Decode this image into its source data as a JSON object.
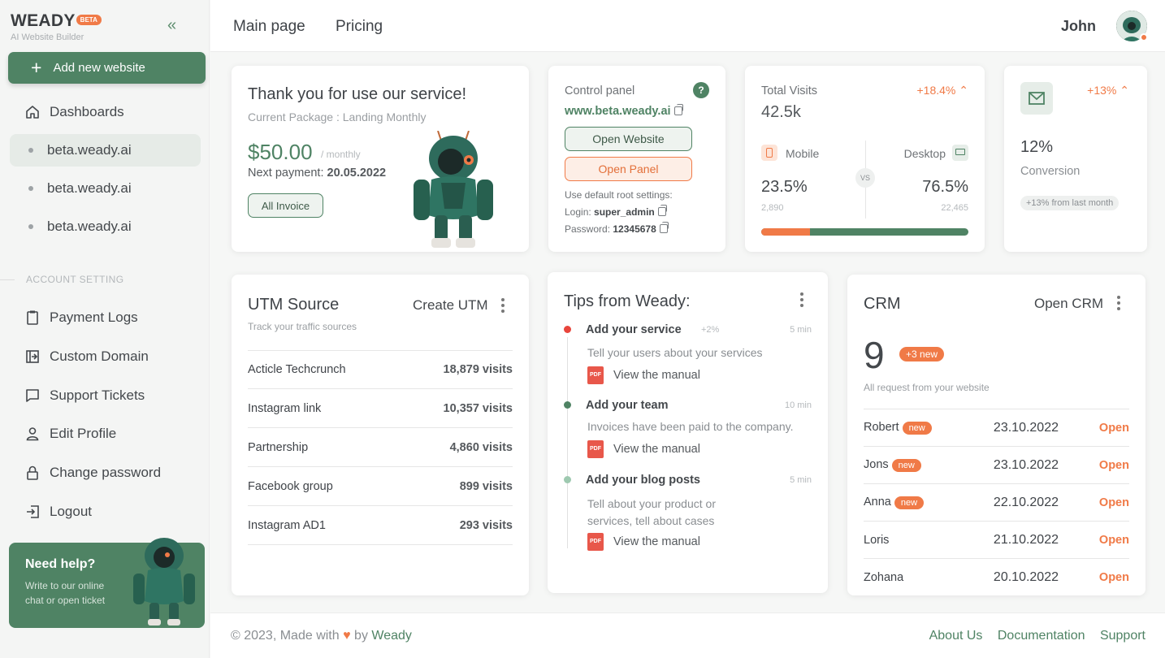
{
  "brand": {
    "name": "WEADY",
    "badge": "BETA",
    "subtitle": "AI Website Builder"
  },
  "sidebar": {
    "add_button": "Add new website",
    "dashboards": "Dashboards",
    "sites": [
      "beta.weady.ai",
      "beta.weady.ai",
      "beta.weady.ai"
    ],
    "section": "ACCOUNT SETTING",
    "items": [
      "Payment Logs",
      "Custom Domain",
      "Support Tickets",
      "Edit Profile",
      "Change password",
      "Logout"
    ],
    "help_title": "Need help?",
    "help_text": "Write to our online chat or open ticket"
  },
  "topbar": {
    "links": [
      "Main page",
      "Pricing"
    ],
    "user": "John"
  },
  "package": {
    "title": "Thank you for use our service!",
    "current": "Current Package : Landing Monthly",
    "price": "$50.00",
    "period": "/ monthly",
    "next_label": "Next payment:",
    "next_date": "20.05.2022",
    "invoice_button": "All Invoice"
  },
  "control": {
    "title": "Control panel",
    "help": "?",
    "domain": "www.beta.weady.ai",
    "open_website": "Open Website",
    "open_panel": "Open Panel",
    "note": "Use  default root settings:",
    "login_label": "Login:",
    "login": "super_admin",
    "password_label": "Password:",
    "password": "12345678"
  },
  "visits": {
    "title": "Total Visits",
    "value": "42.5k",
    "change": "+18.4%",
    "mobile_label": "Mobile",
    "desktop_label": "Desktop",
    "vs": "VS",
    "mobile_pct": "23.5%",
    "desktop_pct": "76.5%",
    "mobile_count": "2,890",
    "desktop_count": "22,465",
    "mobile_share": 0.235
  },
  "conversion": {
    "change": "+13%",
    "value": "12%",
    "label": "Conversion",
    "note": "+13% from last month"
  },
  "utm": {
    "title": "UTM Source",
    "subtitle": "Track your traffic sources",
    "create": "Create UTM",
    "rows": [
      {
        "source": "Acticle Techcrunch",
        "visits": "18,879 visits"
      },
      {
        "source": "Instagram link",
        "visits": "10,357 visits"
      },
      {
        "source": "Partnership",
        "visits": "4,860 visits"
      },
      {
        "source": "Facebook group",
        "visits": "899 visits"
      },
      {
        "source": "Instagram AD1",
        "visits": "293 visits"
      }
    ]
  },
  "tips": {
    "title": "Tips from Weady:",
    "manual": "View the manual",
    "pdf": "PDF",
    "items": [
      {
        "title": "Add your service",
        "extra": "+2%",
        "time": "5 min",
        "text": "Tell your users about your services",
        "color": "#e8453c"
      },
      {
        "title": "Add your team",
        "extra": "",
        "time": "10 min",
        "text": "Invoices have been paid to the company.",
        "color": "#4f8364"
      },
      {
        "title": "Add your blog posts",
        "extra": "",
        "time": "5 min",
        "text": "Tell about your product or services, tell about cases",
        "color": "#9ec9b0"
      }
    ]
  },
  "crm": {
    "title": "CRM",
    "open": "Open CRM",
    "count": "9",
    "new_badge": "+3 new",
    "subtitle": "All request from your website",
    "action": "Open",
    "rows": [
      {
        "name": "Robert",
        "badge": "new",
        "date": "23.10.2022"
      },
      {
        "name": "Jons",
        "badge": "new",
        "date": "23.10.2022"
      },
      {
        "name": "Anna",
        "badge": "new",
        "date": "22.10.2022"
      },
      {
        "name": "Loris",
        "badge": "",
        "date": "21.10.2022"
      },
      {
        "name": "Zohana",
        "badge": "",
        "date": "20.10.2022"
      }
    ]
  },
  "footer": {
    "copy": "© 2023, Made with",
    "by": "by",
    "brand": "Weady",
    "links": [
      "About Us",
      "Documentation",
      "Support"
    ]
  },
  "colors": {
    "accent": "#4f8364",
    "orange": "#f07a47"
  }
}
